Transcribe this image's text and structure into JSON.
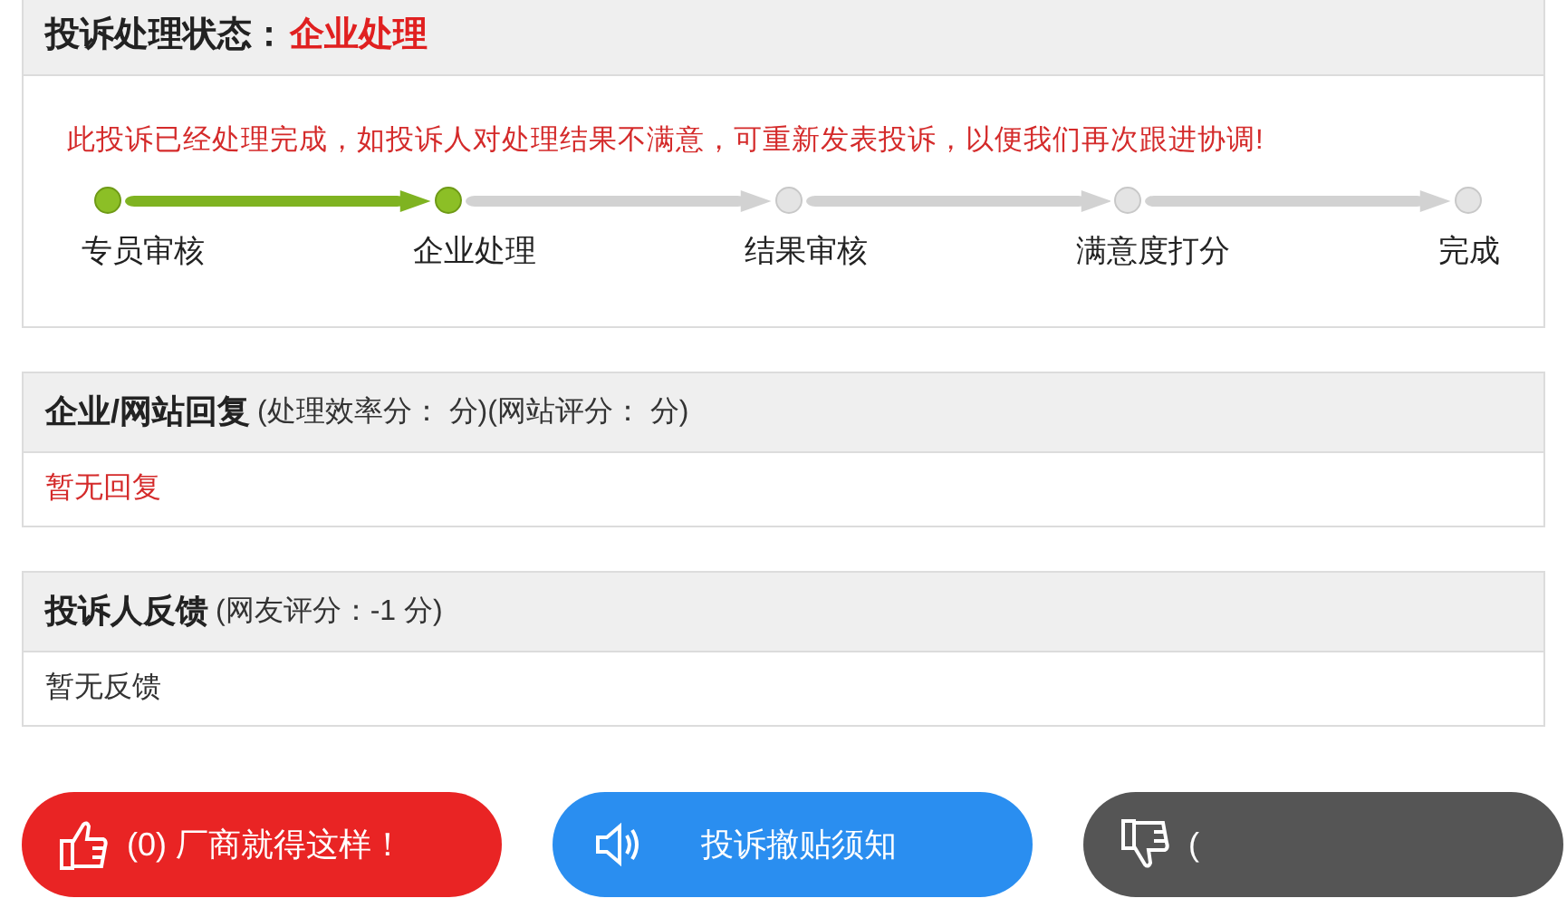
{
  "status_panel": {
    "title": "投诉处理状态：",
    "status": "企业处理",
    "notice": "此投诉已经处理完成，如投诉人对处理结果不满意，可重新发表投诉，以便我们再次跟进协调!",
    "steps": [
      {
        "label": "专员审核",
        "done": true
      },
      {
        "label": "企业处理",
        "done": true
      },
      {
        "label": "结果审核",
        "done": false
      },
      {
        "label": "满意度打分",
        "done": false
      },
      {
        "label": "完成",
        "done": false
      }
    ]
  },
  "reply_panel": {
    "title": "企业/网站回复",
    "note": "(处理效率分： 分)(网站评分： 分)",
    "body": "暂无回复"
  },
  "feedback_panel": {
    "title": "投诉人反馈",
    "note": "(网友评分：-1 分)",
    "body": "暂无反馈"
  },
  "buttons": [
    {
      "kind": "like",
      "label": "(0) 厂商就得这样！"
    },
    {
      "kind": "notice",
      "label": "投诉撤贴须知"
    },
    {
      "kind": "dislike",
      "label": "("
    }
  ]
}
